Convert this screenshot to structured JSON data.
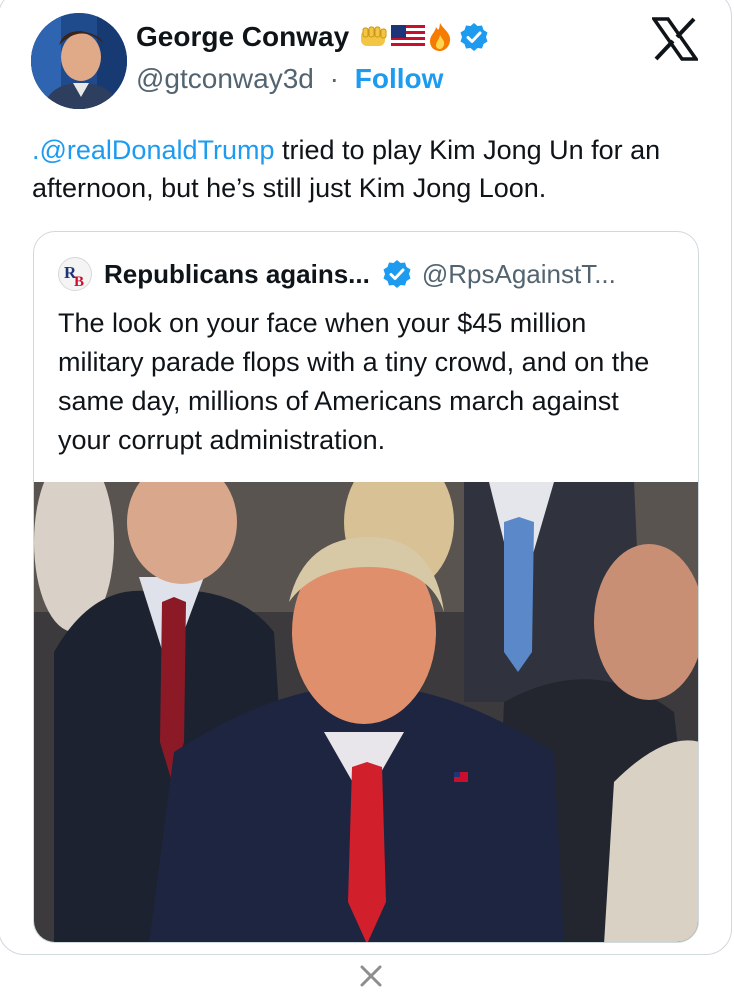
{
  "author": {
    "name": "George Conway",
    "handle": "@gtconway3d",
    "separator": "·",
    "follow_label": "Follow",
    "emojis": [
      "fist-icon",
      "us-flag-icon",
      "fire-icon"
    ],
    "verified": true
  },
  "tweet": {
    "mention": ".@realDonaldTrump",
    "text": " tried to play Kim Jong Un for an afternoon, but he’s still just Kim Jong Loon."
  },
  "quote": {
    "name": "Republicans agains...",
    "handle": "@RpsAgainstT...",
    "verified": true,
    "text": "The look on your face when your $45 million military parade flops with a tiny crowd, and on the same day, millions of Americans march against your corrupt administration."
  },
  "colors": {
    "link": "#1d9bf0",
    "text": "#0f1419",
    "muted": "#536471",
    "border": "#cfd9de"
  }
}
